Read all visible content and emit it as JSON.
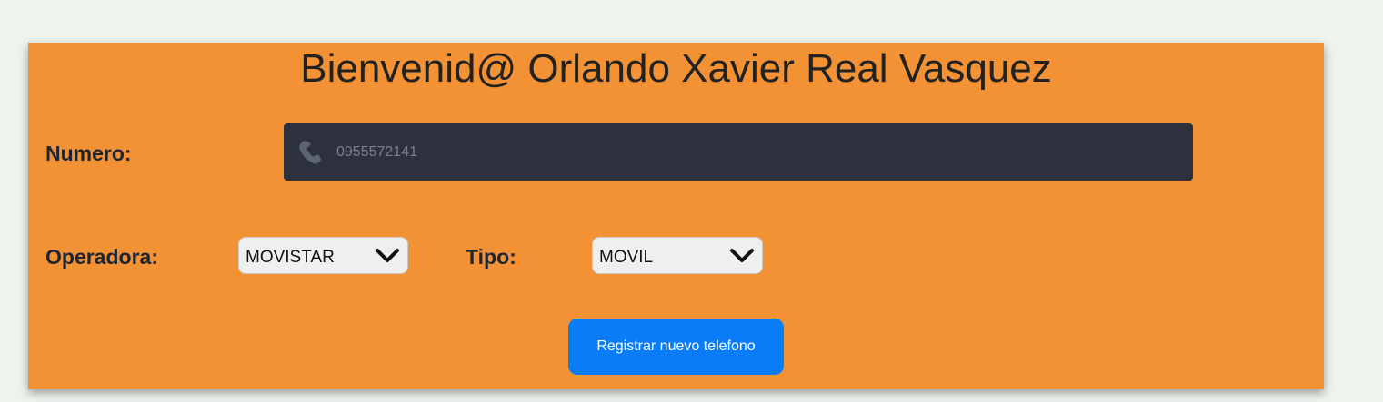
{
  "form": {
    "greeting": "Bienvenid@ Orlando Xavier Real Vasquez",
    "numero_label": "Numero:",
    "numero_placeholder": "0955572141",
    "numero_value": "",
    "operadora_label": "Operadora:",
    "operadora_selected": "MOVISTAR",
    "tipo_label": "Tipo:",
    "tipo_selected": "MOVIL",
    "submit_label": "Registrar nuevo telefono"
  },
  "icons": {
    "phone": "phone-icon",
    "dropdown": "chevron-down-icon"
  },
  "colors": {
    "page_background": "#eef3ee",
    "card_background": "#f39234",
    "input_background": "#2d313d",
    "button_background": "#0a7cf7",
    "label_text": "#1e2430"
  }
}
